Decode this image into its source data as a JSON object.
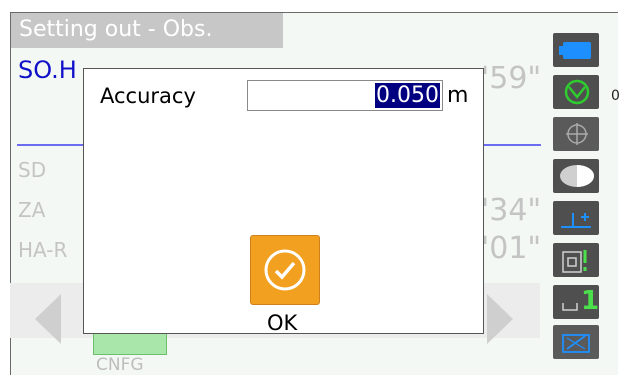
{
  "screen": {
    "title": "Setting out - Obs.",
    "so_label": "SO.H",
    "rows": [
      {
        "label": "SD"
      },
      {
        "label": "ZA"
      },
      {
        "label": "HA-R"
      }
    ],
    "right_values": [
      "'59\"",
      "'34\"",
      "'01\""
    ]
  },
  "sidebar": {
    "items": [
      {
        "icon": "battery-icon",
        "color": "#1e8fff"
      },
      {
        "icon": "prism-target-icon",
        "text": "0",
        "color": "#2ecc2e"
      },
      {
        "icon": "crosshair-icon"
      },
      {
        "icon": "laser-pointer-icon"
      },
      {
        "icon": "tilt-compensation-icon"
      },
      {
        "icon": "memory-card-icon"
      },
      {
        "icon": "input-mode-icon",
        "text": "1"
      },
      {
        "icon": "edit-icon"
      }
    ]
  },
  "bottom": {
    "cnfg_label": "CNFG"
  },
  "dialog": {
    "label": "Accuracy",
    "value": "0.050",
    "unit": "m",
    "ok_label": "OK"
  },
  "colors": {
    "title_bg": "#c7c7c7",
    "value_highlight": "#000080",
    "ok_button": "#f2a01f",
    "sidebar_button": "#4f4f4f"
  }
}
